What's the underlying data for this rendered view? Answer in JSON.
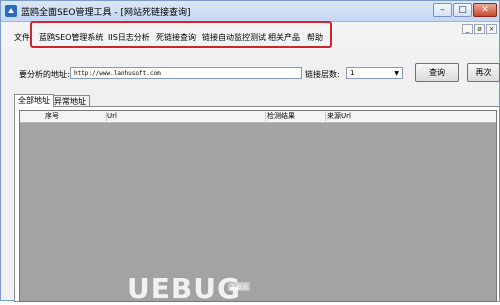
{
  "window": {
    "title": "蓝鸥全面SEO管理工具 - [网站死链接查询]",
    "minimize": "–",
    "maximize": "□",
    "close": "✕"
  },
  "menu": {
    "file": "文件",
    "items": [
      "蓝鸥SEO管理系统",
      "IIS日志分析",
      "死链接查询",
      "链接自动监控测试",
      "相关产品",
      "帮助"
    ]
  },
  "mdi_controls": [
    "_",
    "ø",
    "×"
  ],
  "form": {
    "address_label": "要分析的地址:",
    "address_value": "http://www.lanhusoft.com",
    "depth_label": "链接层数:",
    "depth_value": "1",
    "query_button": "查询",
    "next_button": "再次"
  },
  "tabs": [
    "全部地址",
    "异常地址"
  ],
  "table": {
    "columns": [
      "序号",
      "Url",
      "检测结果",
      "来源Url"
    ]
  },
  "watermark": {
    "logo": "UEBUG",
    "sub": "下载站"
  }
}
